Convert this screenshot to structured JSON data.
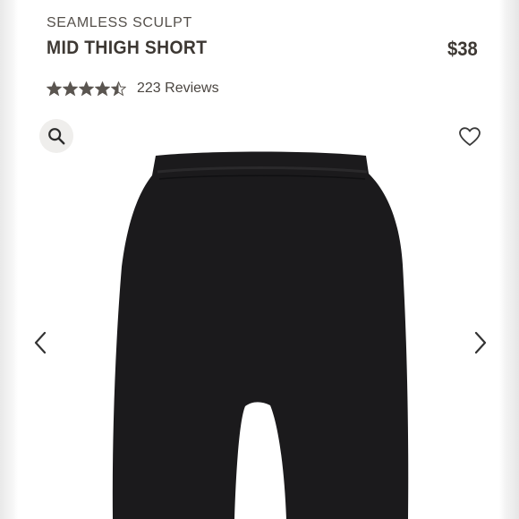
{
  "product": {
    "collection": "SEAMLESS SCULPT",
    "name": "MID THIGH SHORT",
    "price": "$38",
    "rating": 4.5,
    "rating_max": 5,
    "reviews_label": "223 Reviews"
  },
  "icons": {
    "search": "search-icon",
    "wishlist": "heart-icon",
    "prev": "chevron-left-icon",
    "next": "chevron-right-icon",
    "star": "star-icon"
  },
  "colors": {
    "star": "#5a5550",
    "product": "#1b1a1c",
    "text_dark": "#3d3833"
  }
}
